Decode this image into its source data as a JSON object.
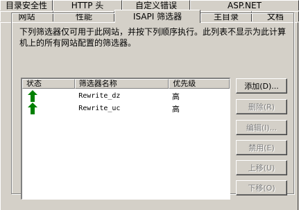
{
  "tabs_back": [
    {
      "label": "目录安全性",
      "width": 76
    },
    {
      "label": "HTTP 头",
      "width": 100
    },
    {
      "label": "自定义错误",
      "width": 98
    },
    {
      "label": "ASP.NET",
      "width": 157
    }
  ],
  "tabs_front": [
    {
      "label": "网站",
      "width": 77
    },
    {
      "label": "性能",
      "width": 88
    },
    {
      "label": "ISAPI 筛选器",
      "width": 124,
      "active": true
    },
    {
      "label": "主目录",
      "width": 74
    },
    {
      "label": "文档",
      "width": 68
    }
  ],
  "description": "下列筛选器仅可用于此网站，并按下列顺序执行。此列表不显示为此计算机上的所有网站配置的筛选器。",
  "list": {
    "columns": [
      "状态",
      "筛选器名称",
      "优先级"
    ],
    "rows": [
      {
        "status_icon": "green-up-arrow-icon",
        "name": "Rewrite_dz",
        "priority": "高"
      },
      {
        "status_icon": "green-up-arrow-icon",
        "name": "Rewrite_uc",
        "priority": "高"
      }
    ]
  },
  "buttons": {
    "add": "添加(D)...",
    "remove": "删除(R)",
    "edit": "编辑(I)...",
    "disable": "禁用(E)",
    "move_up": "上移(U)",
    "move_down": "下移(O)"
  },
  "colors": {
    "dialog_bg": "#d4d0c8",
    "status_arrow": "#008000",
    "disabled_text": "#808080"
  }
}
